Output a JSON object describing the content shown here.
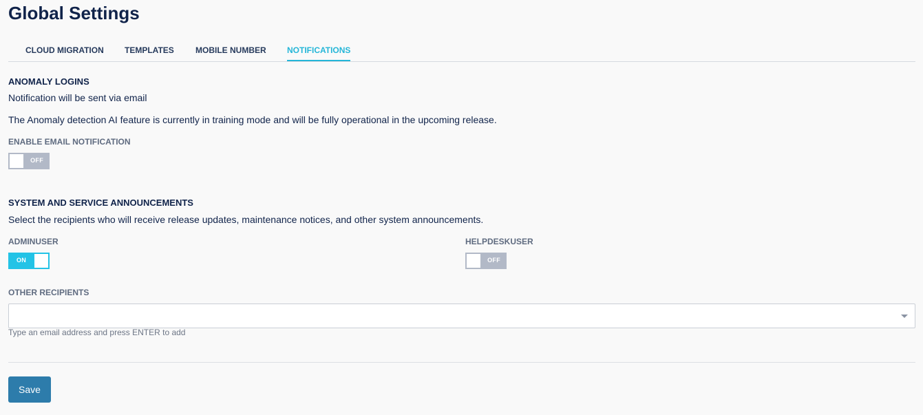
{
  "page": {
    "title": "Global Settings"
  },
  "tabs": [
    {
      "label": "CLOUD MIGRATION",
      "active": false
    },
    {
      "label": "TEMPLATES",
      "active": false
    },
    {
      "label": "MOBILE NUMBER",
      "active": false
    },
    {
      "label": "NOTIFICATIONS",
      "active": true
    }
  ],
  "anomaly": {
    "title": "ANOMALY LOGINS",
    "subtitle": "Notification will be sent via email",
    "description": "The Anomaly detection AI feature is currently in training mode and will be fully operational in the upcoming release.",
    "email_label": "ENABLE EMAIL NOTIFICATION",
    "email_toggle": {
      "state": "OFF",
      "on": false
    }
  },
  "announcements": {
    "title": "SYSTEM AND SERVICE ANNOUNCEMENTS",
    "description": "Select the recipients who will receive release updates, maintenance notices, and other system announcements.",
    "adminuser": {
      "label": "ADMINUSER",
      "state": "ON",
      "on": true
    },
    "helpdeskuser": {
      "label": "HELPDESKUSER",
      "state": "OFF",
      "on": false
    },
    "other_recipients": {
      "label": "OTHER RECIPIENTS",
      "value": "",
      "placeholder": "",
      "hint": "Type an email address and press ENTER to add"
    }
  },
  "actions": {
    "save_label": "Save"
  },
  "colors": {
    "accent": "#25b6d8",
    "toggle_on": "#23c3e6",
    "toggle_off": "#b2b9c7",
    "save_button": "#2d7cab",
    "title_text": "#10234a"
  }
}
